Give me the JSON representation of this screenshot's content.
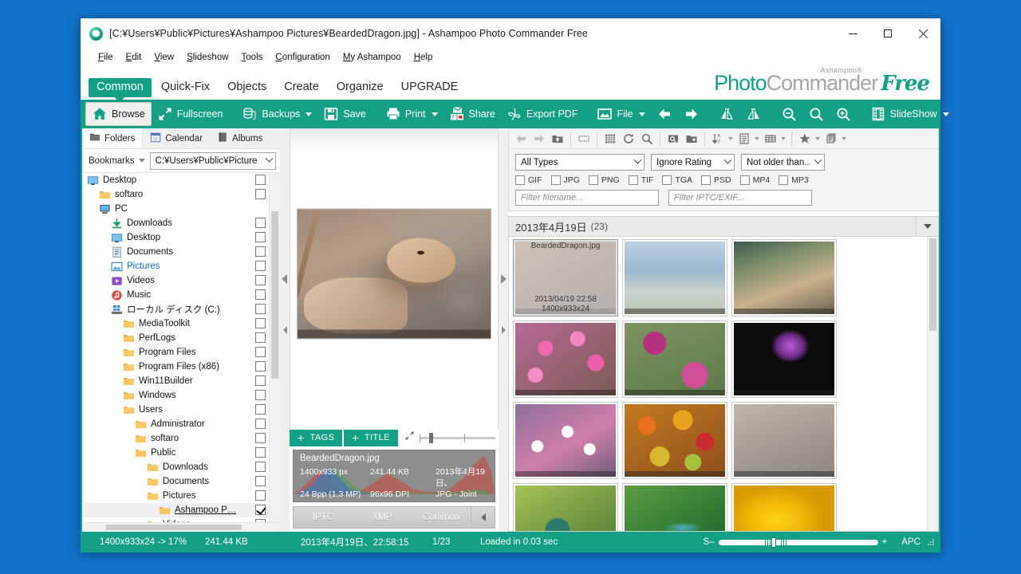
{
  "window": {
    "title": "[C:¥Users¥Public¥Pictures¥Ashampoo Pictures¥BeardedDragon.jpg] - Ashampoo Photo Commander Free",
    "app_icon": "ashampoo-icon",
    "minimize": "—",
    "maximize": "□",
    "close": "✕"
  },
  "menu": {
    "items": [
      "File",
      "Edit",
      "View",
      "Slideshow",
      "Tools",
      "Configuration",
      "My Ashampoo",
      "Help"
    ]
  },
  "brand": {
    "sup": "Ashampoo®",
    "photo": "Photo",
    "commander": "Commander",
    "free": "Free"
  },
  "ribbon_tabs": [
    {
      "label": "Common",
      "active": true
    },
    {
      "label": "Quick-Fix",
      "active": false
    },
    {
      "label": "Objects",
      "active": false
    },
    {
      "label": "Create",
      "active": false
    },
    {
      "label": "Organize",
      "active": false
    },
    {
      "label": "UPGRADE",
      "active": false
    }
  ],
  "toolbar": [
    {
      "label": "Browse",
      "icon": "home-icon",
      "selected": true,
      "dropdown": false
    },
    {
      "label": "Fullscreen",
      "icon": "fullscreen-icon",
      "selected": false,
      "dropdown": false
    },
    {
      "label": "Backups",
      "icon": "backups-icon",
      "selected": false,
      "dropdown": true
    },
    {
      "label": "Save",
      "icon": "save-icon",
      "selected": false,
      "dropdown": false
    },
    {
      "label": "Print",
      "icon": "print-icon",
      "selected": false,
      "dropdown": true
    },
    {
      "label": "Share",
      "icon": "share-icon",
      "selected": false,
      "dropdown": false
    },
    {
      "label": "Export PDF",
      "icon": "pdf-icon",
      "selected": false,
      "dropdown": false
    },
    {
      "label": "File",
      "icon": "picture-icon",
      "selected": false,
      "dropdown": true
    },
    {
      "label": "SlideShow",
      "icon": "filmstrip-icon",
      "selected": false,
      "dropdown": true
    }
  ],
  "toolbar_icon_only": [
    "arrow-left-icon",
    "arrow-right-icon",
    "flip-horizontal-icon",
    "flip-vertical-icon",
    "zoom-out-icon",
    "zoom-fit-icon",
    "zoom-in-icon"
  ],
  "left_panel": {
    "tabs": [
      {
        "label": "Folders",
        "icon": "folders-icon",
        "active": true
      },
      {
        "label": "Calendar",
        "icon": "calendar-icon",
        "active": false
      },
      {
        "label": "Albums",
        "icon": "albums-icon",
        "active": false
      }
    ],
    "bookmarks_label": "Bookmarks",
    "path_value": "C:¥Users¥Public¥Picture",
    "tree": [
      {
        "label": "Desktop",
        "icon": "desktop-icon",
        "indent": 0,
        "checked": false,
        "selected": false,
        "current": false,
        "blue": false
      },
      {
        "label": "softaro",
        "icon": "folder-icon",
        "indent": 1,
        "checked": false,
        "selected": false,
        "current": false,
        "blue": false
      },
      {
        "label": "PC",
        "icon": "pc-icon",
        "indent": 1,
        "checked": false,
        "selected": false,
        "current": false,
        "blue": false,
        "nocheck": true
      },
      {
        "label": "Downloads",
        "icon": "download-icon",
        "indent": 2,
        "checked": false,
        "selected": false,
        "current": false,
        "blue": false
      },
      {
        "label": "Desktop",
        "icon": "desktop-icon",
        "indent": 2,
        "checked": false,
        "selected": false,
        "current": false,
        "blue": false
      },
      {
        "label": "Documents",
        "icon": "documents-icon",
        "indent": 2,
        "checked": false,
        "selected": false,
        "current": false,
        "blue": false
      },
      {
        "label": "Pictures",
        "icon": "pictures-icon",
        "indent": 2,
        "checked": false,
        "selected": false,
        "current": false,
        "blue": true
      },
      {
        "label": "Videos",
        "icon": "videos-icon",
        "indent": 2,
        "checked": false,
        "selected": false,
        "current": false,
        "blue": false
      },
      {
        "label": "Music",
        "icon": "music-icon",
        "indent": 2,
        "checked": false,
        "selected": false,
        "current": false,
        "blue": false
      },
      {
        "label": "ローカル ディスク (C:)",
        "icon": "drive-icon",
        "indent": 2,
        "checked": false,
        "selected": false,
        "current": false,
        "blue": false
      },
      {
        "label": "MediaToolkit",
        "icon": "folder-icon",
        "indent": 3,
        "checked": false,
        "selected": false,
        "current": false,
        "blue": false
      },
      {
        "label": "PerfLogs",
        "icon": "folder-icon",
        "indent": 3,
        "checked": false,
        "selected": false,
        "current": false,
        "blue": false
      },
      {
        "label": "Program Files",
        "icon": "folder-icon",
        "indent": 3,
        "checked": false,
        "selected": false,
        "current": false,
        "blue": false
      },
      {
        "label": "Program Files (x86)",
        "icon": "folder-icon",
        "indent": 3,
        "checked": false,
        "selected": false,
        "current": false,
        "blue": false
      },
      {
        "label": "Win11Builder",
        "icon": "folder-icon",
        "indent": 3,
        "checked": false,
        "selected": false,
        "current": false,
        "blue": false
      },
      {
        "label": "Windows",
        "icon": "folder-icon",
        "indent": 3,
        "checked": false,
        "selected": false,
        "current": false,
        "blue": false
      },
      {
        "label": "Users",
        "icon": "folder-icon",
        "indent": 3,
        "checked": false,
        "selected": false,
        "current": false,
        "blue": false
      },
      {
        "label": "Administrator",
        "icon": "folder-icon",
        "indent": 4,
        "checked": false,
        "selected": false,
        "current": false,
        "blue": false
      },
      {
        "label": "softaro",
        "icon": "folder-icon",
        "indent": 4,
        "checked": false,
        "selected": false,
        "current": false,
        "blue": false
      },
      {
        "label": "Public",
        "icon": "folder-icon",
        "indent": 4,
        "checked": false,
        "selected": false,
        "current": false,
        "blue": false
      },
      {
        "label": "Downloads",
        "icon": "folder-icon",
        "indent": 5,
        "checked": false,
        "selected": false,
        "current": false,
        "blue": false
      },
      {
        "label": "Documents",
        "icon": "folder-icon",
        "indent": 5,
        "checked": false,
        "selected": false,
        "current": false,
        "blue": false
      },
      {
        "label": "Pictures",
        "icon": "folder-icon",
        "indent": 5,
        "checked": false,
        "selected": false,
        "current": false,
        "blue": false
      },
      {
        "label": "Ashampoo P…",
        "icon": "folder-icon",
        "indent": 6,
        "checked": true,
        "selected": true,
        "current": true,
        "blue": false
      },
      {
        "label": "Videos",
        "icon": "folder-icon",
        "indent": 5,
        "checked": false,
        "selected": false,
        "current": false,
        "blue": false
      }
    ]
  },
  "preview": {
    "tags_button": "TAGS",
    "title_button": "TITLE",
    "plus": "+",
    "info": {
      "filename": "BeardedDragon.jpg",
      "dimensions": "1400x933 px",
      "filesize": "241.44 KB",
      "date": "2013年4月19日、",
      "bitdepth": "24 Bpp (1.3 MP)",
      "dpi": "96x96 DPI",
      "format": "JPG - Joint Phot…"
    },
    "meta_tabs": [
      "IPTC",
      "XMP",
      "Common"
    ]
  },
  "right_panel": {
    "toolbar_icons": [
      "back-icon",
      "forward-icon",
      "up-folder-icon",
      "thumbnail-size-icon",
      "grid-view-icon",
      "refresh-icon",
      "search-icon",
      "find-duplicates-icon",
      "new-folder-icon",
      "sort-az-icon",
      "details-icon",
      "table-view-icon",
      "rating-icon",
      "group-icon"
    ],
    "filters": {
      "type_value": "All Types",
      "rating_value": "Ignore Rating",
      "age_value": "Not older than...",
      "checkboxes": [
        "GIF",
        "JPG",
        "PNG",
        "TIF",
        "TGA",
        "PSD",
        "MP4",
        "MP3"
      ],
      "filename_placeholder": "Filter filename...",
      "iptc_placeholder": "Filter IPTC/EXIF..."
    },
    "group_header": "2013年4月19日",
    "group_count": "(23)",
    "thumbnails": [
      {
        "name": "BeardedDragon.jpg",
        "date": "2013/04/19 22:58",
        "size": "1400x933x24",
        "selected": true,
        "art": "dragon"
      },
      {
        "name": "",
        "date": "",
        "size": "",
        "selected": false,
        "art": "butterfly"
      },
      {
        "name": "",
        "date": "",
        "size": "",
        "selected": false,
        "art": "bird"
      },
      {
        "name": "",
        "date": "",
        "size": "",
        "selected": false,
        "art": "pinkflowers"
      },
      {
        "name": "",
        "date": "",
        "size": "",
        "selected": false,
        "art": "clematis"
      },
      {
        "name": "",
        "date": "",
        "size": "",
        "selected": false,
        "art": "smoke"
      },
      {
        "name": "",
        "date": "",
        "size": "",
        "selected": false,
        "art": "daisies"
      },
      {
        "name": "",
        "date": "",
        "size": "",
        "selected": false,
        "art": "fruits"
      },
      {
        "name": "",
        "date": "",
        "size": "",
        "selected": false,
        "art": "grasshopper"
      },
      {
        "name": "",
        "date": "",
        "size": "",
        "selected": false,
        "art": "beetle"
      },
      {
        "name": "",
        "date": "",
        "size": "",
        "selected": false,
        "art": "dragonfly"
      },
      {
        "name": "",
        "date": "",
        "size": "",
        "selected": false,
        "art": "yellowflower"
      }
    ]
  },
  "statusbar": {
    "zoom_info": "1400x933x24 -> 17%",
    "filesize": "241.44 KB",
    "datetime": "2013年4月19日、22:58:15",
    "index": "1/23",
    "loadtime": "Loaded in 0.03 sec",
    "slider_minus": "S–",
    "slider_plus": "+",
    "right_label": "APC"
  },
  "colors": {
    "accent": "#13a085",
    "titlebar": "#ffffff",
    "desktop": "#1273cb",
    "selection": "#f0f0f0"
  }
}
